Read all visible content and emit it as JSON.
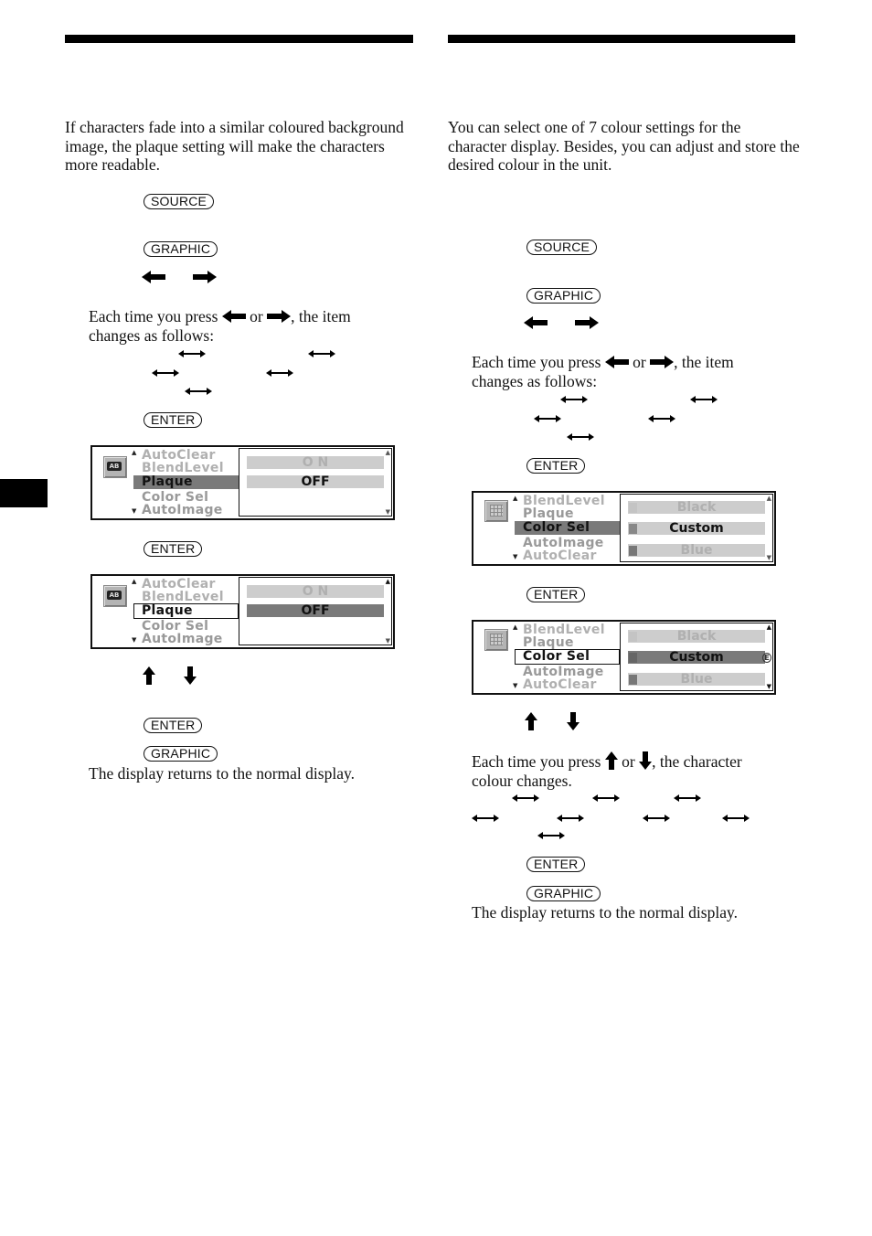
{
  "left": {
    "intro": "If characters fade into a similar coloured background image, the plaque setting will make the characters more readable.",
    "keys": {
      "source": "SOURCE",
      "graphic": "GRAPHIC",
      "enter": "ENTER"
    },
    "arrow_text": {
      "prefix": "Each time you press",
      "or": "or",
      "suffix": ", the item",
      "line2": "changes as follows:"
    },
    "display1": {
      "icon": "AB",
      "menu": [
        "AutoClear",
        "BlendLevel",
        "Plaque",
        "Color   Sel",
        "AutoImage"
      ],
      "options": [
        "O N",
        "OFF"
      ],
      "selected_menu": "Plaque",
      "selected_option": "OFF"
    },
    "display2": {
      "icon": "AB",
      "menu": [
        "AutoClear",
        "BlendLevel",
        "Plaque",
        "Color   Sel",
        "AutoImage"
      ],
      "options": [
        "O N",
        "OFF"
      ],
      "selected_menu": "Plaque",
      "selected_option": "OFF"
    },
    "closing": "The display returns to the normal display."
  },
  "right": {
    "intro": "You can select one of 7 colour settings for the character display. Besides, you can adjust and store the desired colour in the unit.",
    "keys": {
      "source": "SOURCE",
      "graphic": "GRAPHIC",
      "enter": "ENTER"
    },
    "arrow_text": {
      "prefix": "Each time you press",
      "or": "or",
      "suffix": ", the item",
      "line2": "changes as follows:"
    },
    "display1": {
      "menu": [
        "BlendLevel",
        "Plaque",
        "Color   Sel",
        "AutoImage",
        "AutoClear"
      ],
      "options": [
        "Black",
        "Custom",
        "Blue"
      ],
      "selected_menu": "Color Sel",
      "selected_option": "Custom"
    },
    "display2": {
      "menu": [
        "BlendLevel",
        "Plaque",
        "Color   Sel",
        "AutoImage",
        "AutoClear"
      ],
      "options": [
        "Black",
        "Custom",
        "Blue"
      ],
      "selected_menu": "Color Sel",
      "selected_option": "Custom",
      "edit_marker": "E"
    },
    "updown_text": {
      "prefix": "Each time you press",
      "or": "or",
      "suffix": ", the character",
      "line2": "colour changes."
    },
    "closing": "The display returns to the normal display."
  },
  "colors": {
    "rule": "#000000",
    "lcd_highlight": "#7a7a7a",
    "lcd_option_bg": "#cdcdcd",
    "lcd_dim_text": "#b0b0b0"
  }
}
